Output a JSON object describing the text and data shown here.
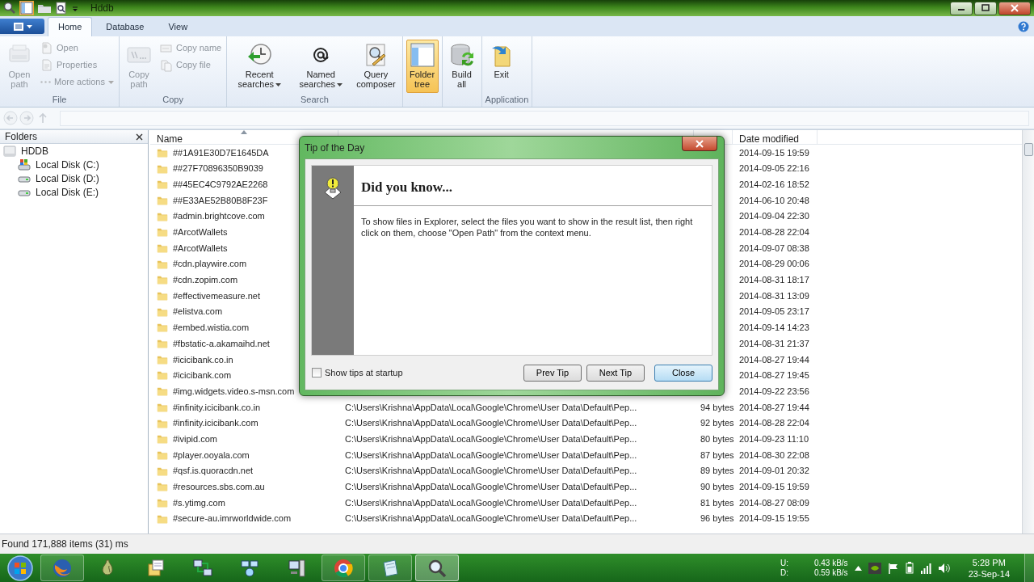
{
  "window": {
    "title": "Hddb"
  },
  "ribbon": {
    "tabs": [
      {
        "label": "Home",
        "selected": true
      },
      {
        "label": "Database",
        "selected": false
      },
      {
        "label": "View",
        "selected": false
      }
    ],
    "groups": [
      {
        "label": "File",
        "items": [
          {
            "kind": "large",
            "label": "Open path",
            "disabled": true
          },
          {
            "kind": "small",
            "label": "Open",
            "disabled": true
          },
          {
            "kind": "small",
            "label": "Properties",
            "disabled": true
          },
          {
            "kind": "small",
            "label": "More actions",
            "disabled": true,
            "dropdown": true
          }
        ]
      },
      {
        "label": "Copy",
        "items": [
          {
            "kind": "large",
            "label": "Copy path",
            "disabled": true
          },
          {
            "kind": "small",
            "label": "Copy name",
            "disabled": true
          },
          {
            "kind": "small",
            "label": "Copy file",
            "disabled": true
          }
        ]
      },
      {
        "label": "Search",
        "items": [
          {
            "kind": "large",
            "label": "Recent searches",
            "disabled": false,
            "dropdown": true
          },
          {
            "kind": "large",
            "label": "Named searches",
            "disabled": false,
            "dropdown": true
          },
          {
            "kind": "large",
            "label": "Query composer",
            "disabled": false
          }
        ]
      },
      {
        "items": [
          {
            "kind": "large",
            "label": "Folder tree",
            "disabled": false,
            "on": true
          }
        ]
      },
      {
        "items": [
          {
            "kind": "large",
            "label": "Build all",
            "disabled": false
          }
        ]
      },
      {
        "label": "Application",
        "items": [
          {
            "kind": "large",
            "label": "Exit",
            "disabled": false
          }
        ]
      }
    ]
  },
  "nav_buttons": [
    {
      "disabled": true
    },
    {
      "disabled": true
    },
    {
      "disabled": true
    }
  ],
  "folders_pane": {
    "title": "Folders",
    "tree": [
      {
        "label": "HDDB",
        "children": [
          {
            "label": "Local Disk (C:)"
          },
          {
            "label": "Local Disk (D:)"
          },
          {
            "label": "Local Disk (E:)"
          }
        ]
      }
    ]
  },
  "file_list": {
    "columns": [
      {
        "label": "Name",
        "sorted": true
      },
      {
        "label": "Date modified"
      }
    ],
    "rows": [
      {
        "name": "##1A91E30D7E1645DA",
        "date": "2014-09-15 19:59"
      },
      {
        "name": "##27F70896350B9039",
        "date": "2014-09-05 22:16"
      },
      {
        "name": "##45EC4C9792AE2268",
        "date": "2014-02-16 18:52"
      },
      {
        "name": "##E33AE52B80B8F23F",
        "date": "2014-06-10 20:48"
      },
      {
        "name": "#admin.brightcove.com",
        "date": "2014-09-04 22:30"
      },
      {
        "name": "#ArcotWallets",
        "date": "2014-08-28 22:04"
      },
      {
        "name": "#ArcotWallets",
        "date": "2014-09-07 08:38"
      },
      {
        "name": "#cdn.playwire.com",
        "date": "2014-08-29 00:06"
      },
      {
        "name": "#cdn.zopim.com",
        "date": "2014-08-31 18:17"
      },
      {
        "name": "#effectivemeasure.net",
        "date": "2014-08-31 13:09"
      },
      {
        "name": "#elistva.com",
        "date": "2014-09-05 23:17"
      },
      {
        "name": "#embed.wistia.com",
        "date": "2014-09-14 14:23"
      },
      {
        "name": "#fbstatic-a.akamaihd.net",
        "date": "2014-08-31 21:37"
      },
      {
        "name": "#icicibank.co.in",
        "date": "2014-08-27 19:44"
      },
      {
        "name": "#icicibank.com",
        "date": "2014-08-27 19:45"
      },
      {
        "name": "#img.widgets.video.s-msn.com",
        "date": "2014-09-22 23:56"
      },
      {
        "name": "#infinity.icicibank.co.in",
        "path": "C:\\Users\\Krishna\\AppData\\Local\\Google\\Chrome\\User Data\\Default\\Pep...",
        "size": "94 bytes",
        "date": "2014-08-27 19:44"
      },
      {
        "name": "#infinity.icicibank.com",
        "path": "C:\\Users\\Krishna\\AppData\\Local\\Google\\Chrome\\User Data\\Default\\Pep...",
        "size": "92 bytes",
        "date": "2014-08-28 22:04"
      },
      {
        "name": "#ivipid.com",
        "path": "C:\\Users\\Krishna\\AppData\\Local\\Google\\Chrome\\User Data\\Default\\Pep...",
        "size": "80 bytes",
        "date": "2014-09-23 11:10"
      },
      {
        "name": "#player.ooyala.com",
        "path": "C:\\Users\\Krishna\\AppData\\Local\\Google\\Chrome\\User Data\\Default\\Pep...",
        "size": "87 bytes",
        "date": "2014-08-30 22:08"
      },
      {
        "name": "#qsf.is.quoracdn.net",
        "path": "C:\\Users\\Krishna\\AppData\\Local\\Google\\Chrome\\User Data\\Default\\Pep...",
        "size": "89 bytes",
        "date": "2014-09-01 20:32"
      },
      {
        "name": "#resources.sbs.com.au",
        "path": "C:\\Users\\Krishna\\AppData\\Local\\Google\\Chrome\\User Data\\Default\\Pep...",
        "size": "90 bytes",
        "date": "2014-09-15 19:59"
      },
      {
        "name": "#s.ytimg.com",
        "path": "C:\\Users\\Krishna\\AppData\\Local\\Google\\Chrome\\User Data\\Default\\Pep...",
        "size": "81 bytes",
        "date": "2014-08-27 08:09"
      },
      {
        "name": "#secure-au.imrworldwide.com",
        "path": "C:\\Users\\Krishna\\AppData\\Local\\Google\\Chrome\\User Data\\Default\\Pep...",
        "size": "96 bytes",
        "date": "2014-09-15 19:55"
      }
    ]
  },
  "dialog": {
    "title": "Tip of the Day",
    "heading": "Did you know...",
    "text": "To show files in Explorer, select the files you want to show in the result list, then right click on them, choose \"Open Path\" from the context menu.",
    "checkbox": {
      "label": "Show tips at startup",
      "checked": false
    },
    "buttons": [
      {
        "label": "Prev Tip",
        "default": false
      },
      {
        "label": "Next Tip",
        "default": false
      },
      {
        "label": "Close",
        "default": true
      }
    ]
  },
  "status_bar": {
    "text": "Found 171,888 items (31) ms"
  },
  "taskbar": {
    "items": [
      {
        "running": true,
        "active": false
      },
      {
        "running": false,
        "active": false
      },
      {
        "running": false,
        "active": false
      },
      {
        "running": false,
        "active": false
      },
      {
        "running": false,
        "active": false
      },
      {
        "running": false,
        "active": false
      },
      {
        "running": true,
        "active": false
      },
      {
        "running": true,
        "active": false
      },
      {
        "running": true,
        "active": true
      }
    ],
    "speed": [
      {
        "label": "U:",
        "value": "0.43 kB/s"
      },
      {
        "label": "D:",
        "value": "0.59 kB/s"
      }
    ],
    "clock": {
      "time": "5:28 PM",
      "date": "23-Sep-14"
    }
  }
}
